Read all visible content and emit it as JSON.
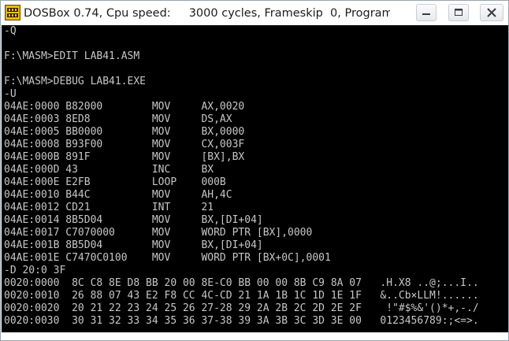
{
  "window": {
    "title": "DOSBox 0.74, Cpu speed:     3000 cycles, Frameskip  0, Program:"
  },
  "icons": {
    "app": "dosbox-box-icon",
    "minimize": "minimize-icon",
    "maximize": "maximize-icon",
    "close": "close-icon"
  },
  "colors": {
    "console_background": "#000000",
    "console_text": "#c6c6c6",
    "titlebar_background": "#ffffff"
  },
  "console": {
    "lines": [
      "-Q",
      "",
      "F:\\MASM>EDIT LAB41.ASM",
      "",
      "F:\\MASM>DEBUG LAB41.EXE",
      "-U",
      "04AE:0000 B82000        MOV     AX,0020",
      "04AE:0003 8ED8          MOV     DS,AX",
      "04AE:0005 BB0000        MOV     BX,0000",
      "04AE:0008 B93F00        MOV     CX,003F",
      "04AE:000B 891F          MOV     [BX],BX",
      "04AE:000D 43            INC     BX",
      "04AE:000E E2FB          LOOP    000B",
      "04AE:0010 B44C          MOV     AH,4C",
      "04AE:0012 CD21          INT     21",
      "04AE:0014 8B5D04        MOV     BX,[DI+04]",
      "04AE:0017 C7070000      MOV     WORD PTR [BX],0000",
      "04AE:001B 8B5D04        MOV     BX,[DI+04]",
      "04AE:001E C7470C0100    MOV     WORD PTR [BX+0C],0001",
      "-D 20:0 3F",
      "0020:0000  8C C8 8E D8 BB 20 00 8E-C0 BB 00 00 8B C9 8A 07   .H.X8 ..@;...I..",
      "0020:0010  26 88 07 43 E2 F8 CC 4C-CD 21 1A 1B 1C 1D 1E 1F   &..Cb×LLM!......",
      "0020:0020  20 21 22 23 24 25 26 27-28 29 2A 2B 2C 2D 2E 2F    !\"#$%&'()*+,-./",
      "0020:0030  30 31 32 33 34 35 36 37-38 39 3A 3B 3C 3D 3E 00   0123456789:;<=>."
    ]
  }
}
